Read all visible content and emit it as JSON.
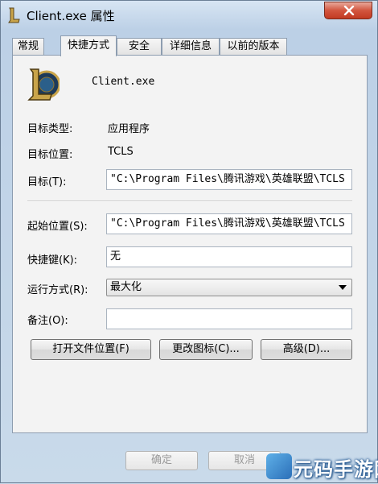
{
  "window": {
    "title": "Client.exe 属性",
    "close_icon": "close-icon"
  },
  "tabs": [
    {
      "label": "常规",
      "active": false
    },
    {
      "label": "快捷方式",
      "active": true
    },
    {
      "label": "安全",
      "active": false
    },
    {
      "label": "详细信息",
      "active": false
    },
    {
      "label": "以前的版本",
      "active": false
    }
  ],
  "shortcut": {
    "app_icon": "league-of-legends-icon",
    "app_name": "Client.exe",
    "target_type_label": "目标类型:",
    "target_type_value": "应用程序",
    "target_location_label": "目标位置:",
    "target_location_value": "TCLS",
    "target_label": "目标(T):",
    "target_value": "\"C:\\Program Files\\腾讯游戏\\英雄联盟\\TCLS",
    "start_in_label": "起始位置(S):",
    "start_in_value": "\"C:\\Program Files\\腾讯游戏\\英雄联盟\\TCLS",
    "hotkey_label": "快捷键(K):",
    "hotkey_value": "无",
    "run_label": "运行方式(R):",
    "run_value": "最大化",
    "comment_label": "备注(O):",
    "comment_value": ""
  },
  "buttons": {
    "open_location": "打开文件位置(F)",
    "change_icon": "更改图标(C)...",
    "advanced": "高级(D)..."
  },
  "footer": {
    "ok": "确定",
    "cancel": "取消"
  },
  "watermark": {
    "text": "元码手游网"
  }
}
